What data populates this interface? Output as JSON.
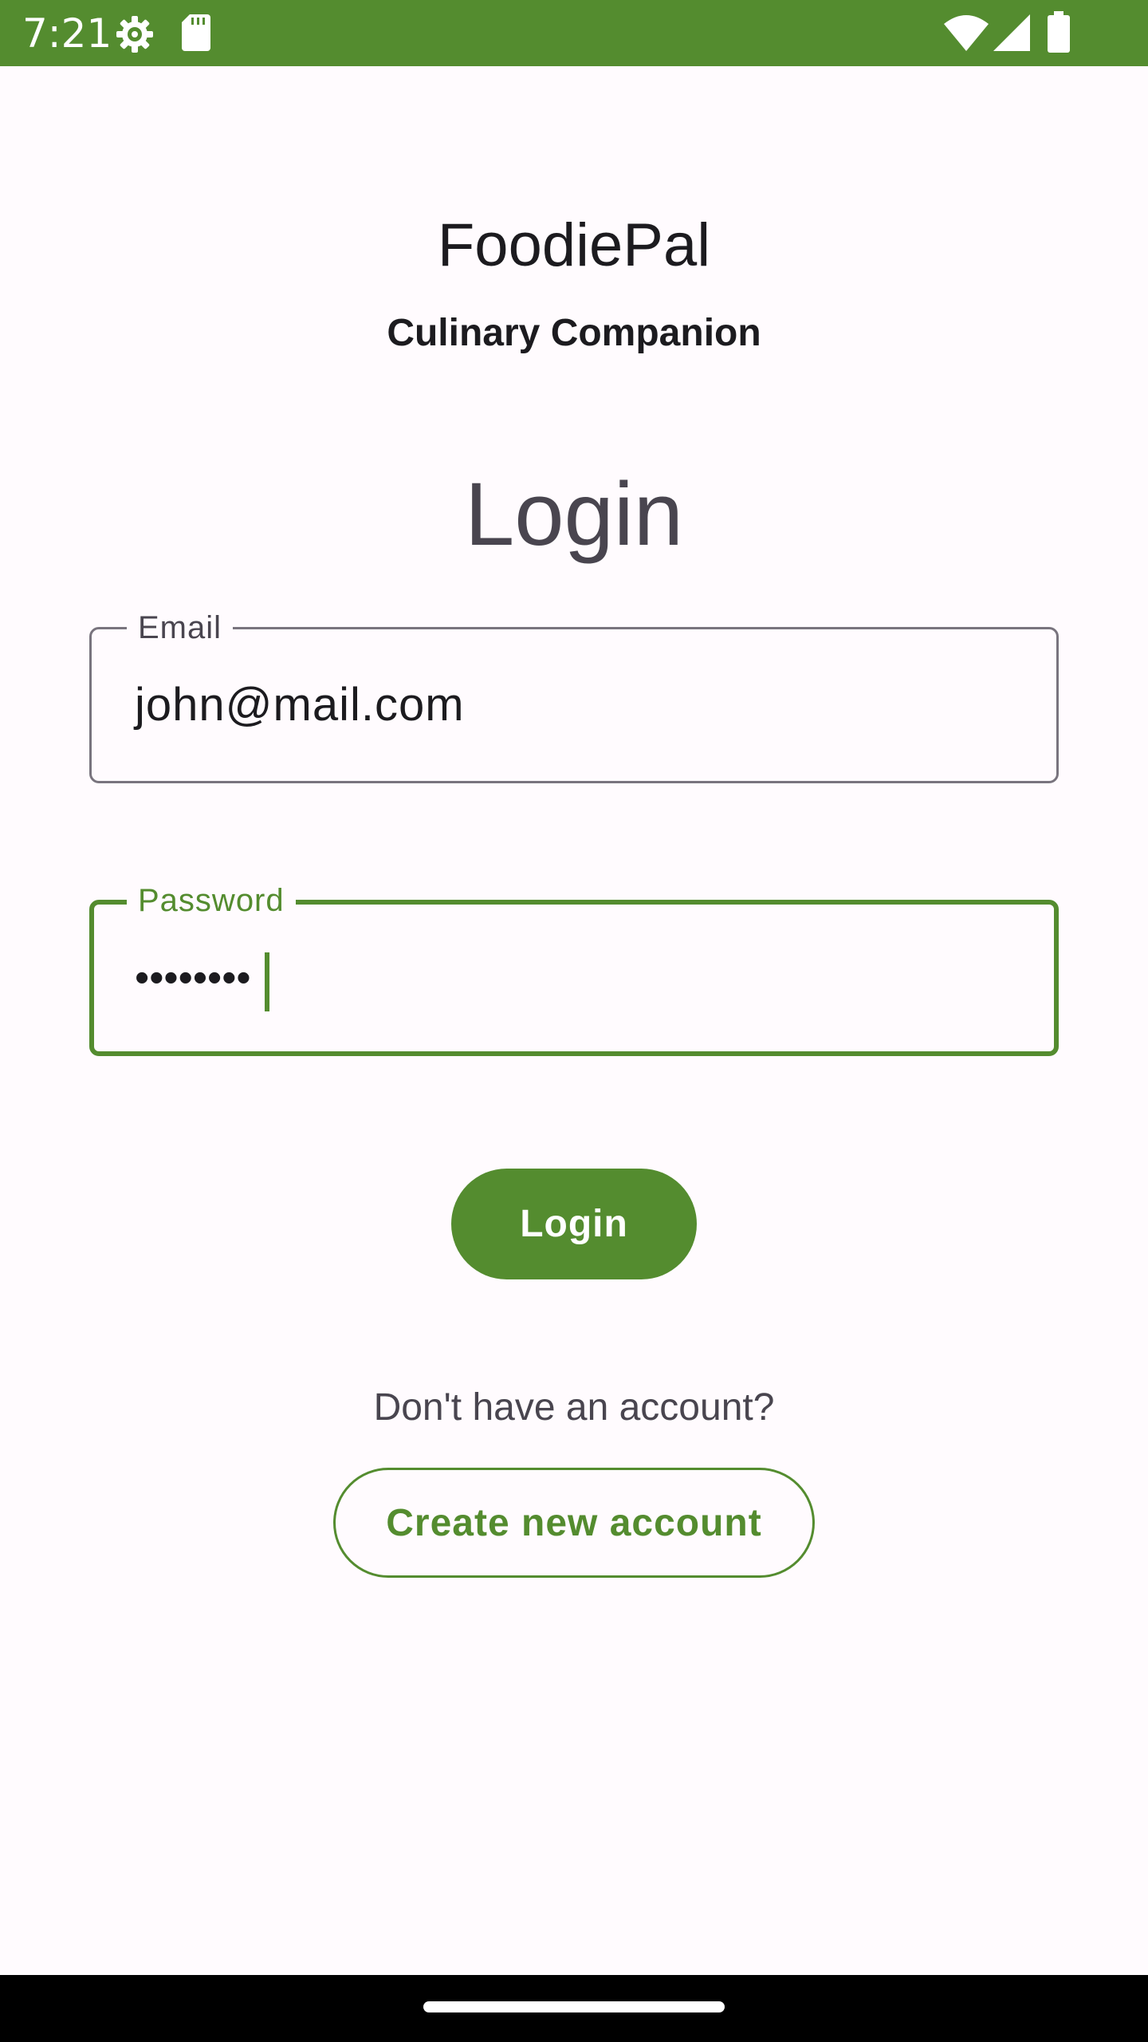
{
  "status_bar": {
    "time": "7:21",
    "background_color": "#548C2F",
    "icons_left": [
      "settings-gear-icon",
      "sd-card-icon"
    ],
    "icons_right": [
      "wifi-icon",
      "cell-signal-icon",
      "battery-icon"
    ]
  },
  "app": {
    "title": "FoodiePal",
    "subtitle": "Culinary Companion"
  },
  "form": {
    "heading": "Login",
    "email": {
      "label": "Email",
      "value": "john@mail.com"
    },
    "password": {
      "label": "Password",
      "value": "••••••••",
      "focused": true
    },
    "login_button": "Login",
    "no_account_text": "Don't have an account?",
    "create_account_button": "Create new account"
  },
  "colors": {
    "primary": "#548C2F",
    "background": "#FFFBFE",
    "on_surface": "#1C1B1F",
    "on_surface_variant": "#49454F",
    "outline": "#79747E"
  }
}
